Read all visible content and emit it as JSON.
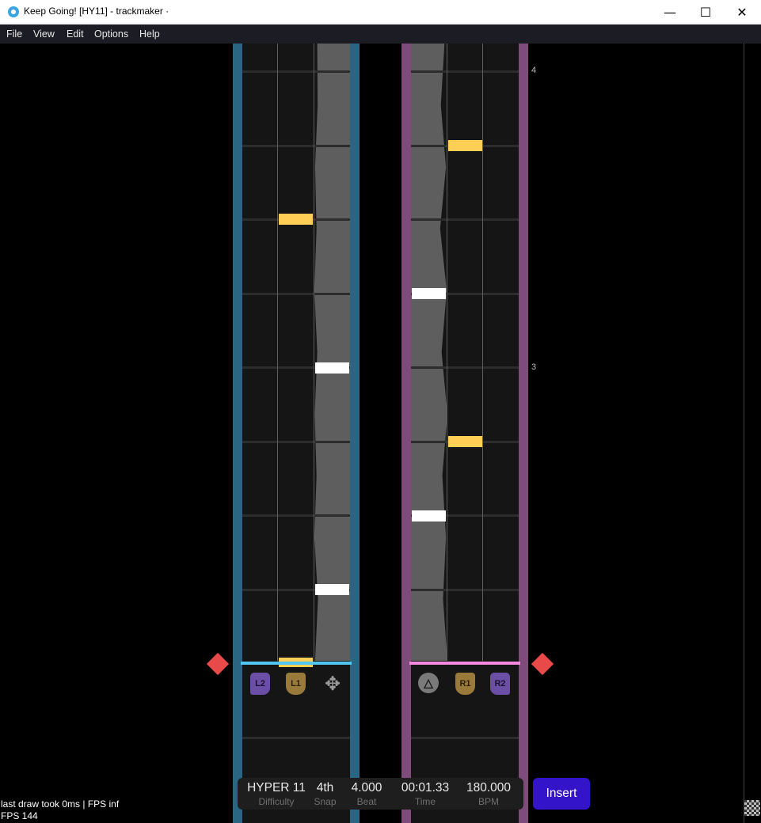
{
  "window": {
    "title": "Keep Going! [HY11] - trackmaker ·",
    "minimize": "—",
    "maximize": "☐",
    "close": "✕"
  },
  "menu": [
    "File",
    "View",
    "Edit",
    "Options",
    "Help"
  ],
  "colors": {
    "left_rail": "#2a6584",
    "right_rail": "#7e4b7a",
    "left_judge": "#52c6f2",
    "right_judge": "#f78ae0",
    "note_yellow": "#ffcf55",
    "note_white": "#ffffff",
    "marker": "#e84a4a",
    "insert_button": "#3414c8"
  },
  "beat_markers": [
    "4",
    "3"
  ],
  "left_lane_icons": [
    {
      "icon": "l2-trigger-icon",
      "label": "L2",
      "color": "#6b4ea6"
    },
    {
      "icon": "l1-bumper-icon",
      "label": "L1",
      "color": "#9a7a3a"
    },
    {
      "icon": "dpad-icon",
      "label": "✥",
      "color": "#9a9a9a"
    }
  ],
  "right_lane_icons": [
    {
      "icon": "triangle-button-icon",
      "label": "△",
      "color": "#7a7a7a"
    },
    {
      "icon": "r1-bumper-icon",
      "label": "R1",
      "color": "#9a7a3a"
    },
    {
      "icon": "r2-trigger-icon",
      "label": "R2",
      "color": "#6b4ea6"
    }
  ],
  "status": {
    "difficulty": {
      "value": "HYPER 11",
      "label": "Difficulty"
    },
    "snap": {
      "value": "4th",
      "label": "Snap"
    },
    "beat": {
      "value": "4.000",
      "label": "Beat"
    },
    "time": {
      "value": "00:01.33",
      "label": "Time"
    },
    "bpm": {
      "value": "180.000",
      "label": "BPM"
    }
  },
  "insert_label": "Insert",
  "debug": {
    "line1": "last draw took 0ms | FPS inf",
    "line2": "FPS 144"
  }
}
